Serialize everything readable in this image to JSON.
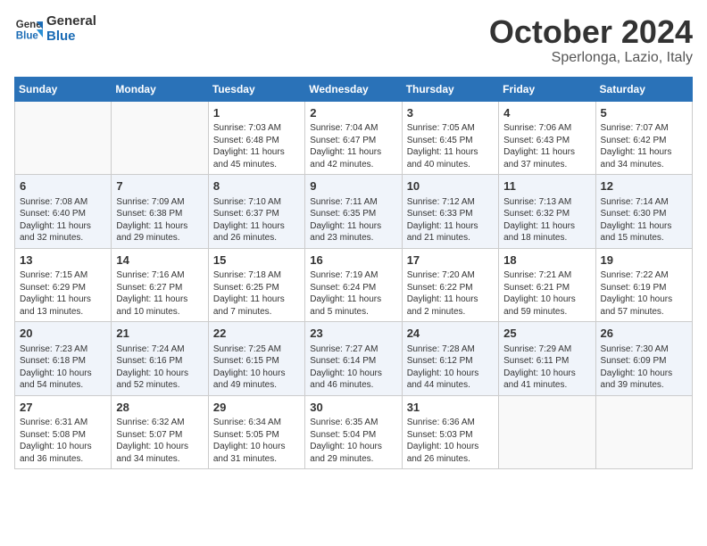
{
  "header": {
    "logo_line1": "General",
    "logo_line2": "Blue",
    "month": "October 2024",
    "location": "Sperlonga, Lazio, Italy"
  },
  "weekdays": [
    "Sunday",
    "Monday",
    "Tuesday",
    "Wednesday",
    "Thursday",
    "Friday",
    "Saturday"
  ],
  "weeks": [
    [
      {
        "day": "",
        "info": ""
      },
      {
        "day": "",
        "info": ""
      },
      {
        "day": "1",
        "info": "Sunrise: 7:03 AM\nSunset: 6:48 PM\nDaylight: 11 hours and 45 minutes."
      },
      {
        "day": "2",
        "info": "Sunrise: 7:04 AM\nSunset: 6:47 PM\nDaylight: 11 hours and 42 minutes."
      },
      {
        "day": "3",
        "info": "Sunrise: 7:05 AM\nSunset: 6:45 PM\nDaylight: 11 hours and 40 minutes."
      },
      {
        "day": "4",
        "info": "Sunrise: 7:06 AM\nSunset: 6:43 PM\nDaylight: 11 hours and 37 minutes."
      },
      {
        "day": "5",
        "info": "Sunrise: 7:07 AM\nSunset: 6:42 PM\nDaylight: 11 hours and 34 minutes."
      }
    ],
    [
      {
        "day": "6",
        "info": "Sunrise: 7:08 AM\nSunset: 6:40 PM\nDaylight: 11 hours and 32 minutes."
      },
      {
        "day": "7",
        "info": "Sunrise: 7:09 AM\nSunset: 6:38 PM\nDaylight: 11 hours and 29 minutes."
      },
      {
        "day": "8",
        "info": "Sunrise: 7:10 AM\nSunset: 6:37 PM\nDaylight: 11 hours and 26 minutes."
      },
      {
        "day": "9",
        "info": "Sunrise: 7:11 AM\nSunset: 6:35 PM\nDaylight: 11 hours and 23 minutes."
      },
      {
        "day": "10",
        "info": "Sunrise: 7:12 AM\nSunset: 6:33 PM\nDaylight: 11 hours and 21 minutes."
      },
      {
        "day": "11",
        "info": "Sunrise: 7:13 AM\nSunset: 6:32 PM\nDaylight: 11 hours and 18 minutes."
      },
      {
        "day": "12",
        "info": "Sunrise: 7:14 AM\nSunset: 6:30 PM\nDaylight: 11 hours and 15 minutes."
      }
    ],
    [
      {
        "day": "13",
        "info": "Sunrise: 7:15 AM\nSunset: 6:29 PM\nDaylight: 11 hours and 13 minutes."
      },
      {
        "day": "14",
        "info": "Sunrise: 7:16 AM\nSunset: 6:27 PM\nDaylight: 11 hours and 10 minutes."
      },
      {
        "day": "15",
        "info": "Sunrise: 7:18 AM\nSunset: 6:25 PM\nDaylight: 11 hours and 7 minutes."
      },
      {
        "day": "16",
        "info": "Sunrise: 7:19 AM\nSunset: 6:24 PM\nDaylight: 11 hours and 5 minutes."
      },
      {
        "day": "17",
        "info": "Sunrise: 7:20 AM\nSunset: 6:22 PM\nDaylight: 11 hours and 2 minutes."
      },
      {
        "day": "18",
        "info": "Sunrise: 7:21 AM\nSunset: 6:21 PM\nDaylight: 10 hours and 59 minutes."
      },
      {
        "day": "19",
        "info": "Sunrise: 7:22 AM\nSunset: 6:19 PM\nDaylight: 10 hours and 57 minutes."
      }
    ],
    [
      {
        "day": "20",
        "info": "Sunrise: 7:23 AM\nSunset: 6:18 PM\nDaylight: 10 hours and 54 minutes."
      },
      {
        "day": "21",
        "info": "Sunrise: 7:24 AM\nSunset: 6:16 PM\nDaylight: 10 hours and 52 minutes."
      },
      {
        "day": "22",
        "info": "Sunrise: 7:25 AM\nSunset: 6:15 PM\nDaylight: 10 hours and 49 minutes."
      },
      {
        "day": "23",
        "info": "Sunrise: 7:27 AM\nSunset: 6:14 PM\nDaylight: 10 hours and 46 minutes."
      },
      {
        "day": "24",
        "info": "Sunrise: 7:28 AM\nSunset: 6:12 PM\nDaylight: 10 hours and 44 minutes."
      },
      {
        "day": "25",
        "info": "Sunrise: 7:29 AM\nSunset: 6:11 PM\nDaylight: 10 hours and 41 minutes."
      },
      {
        "day": "26",
        "info": "Sunrise: 7:30 AM\nSunset: 6:09 PM\nDaylight: 10 hours and 39 minutes."
      }
    ],
    [
      {
        "day": "27",
        "info": "Sunrise: 6:31 AM\nSunset: 5:08 PM\nDaylight: 10 hours and 36 minutes."
      },
      {
        "day": "28",
        "info": "Sunrise: 6:32 AM\nSunset: 5:07 PM\nDaylight: 10 hours and 34 minutes."
      },
      {
        "day": "29",
        "info": "Sunrise: 6:34 AM\nSunset: 5:05 PM\nDaylight: 10 hours and 31 minutes."
      },
      {
        "day": "30",
        "info": "Sunrise: 6:35 AM\nSunset: 5:04 PM\nDaylight: 10 hours and 29 minutes."
      },
      {
        "day": "31",
        "info": "Sunrise: 6:36 AM\nSunset: 5:03 PM\nDaylight: 10 hours and 26 minutes."
      },
      {
        "day": "",
        "info": ""
      },
      {
        "day": "",
        "info": ""
      }
    ]
  ]
}
